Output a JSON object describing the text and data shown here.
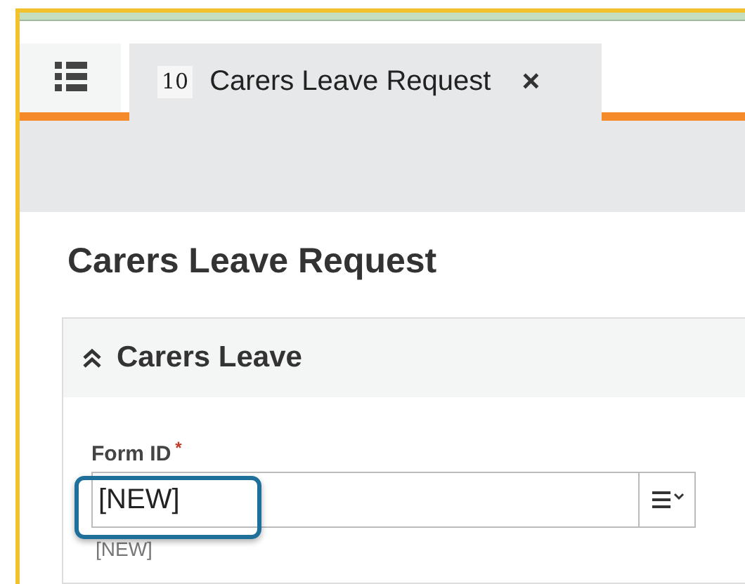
{
  "tab": {
    "number": "10",
    "title": "Carers Leave Request",
    "close": "×",
    "selected": true
  },
  "page_title": "Carers Leave Request",
  "section": {
    "title": "Carers Leave",
    "expanded": true
  },
  "field": {
    "label": "Form ID",
    "required": true,
    "required_mark": "*",
    "value": "[NEW]",
    "hint": "[NEW]",
    "highlighted": true
  }
}
